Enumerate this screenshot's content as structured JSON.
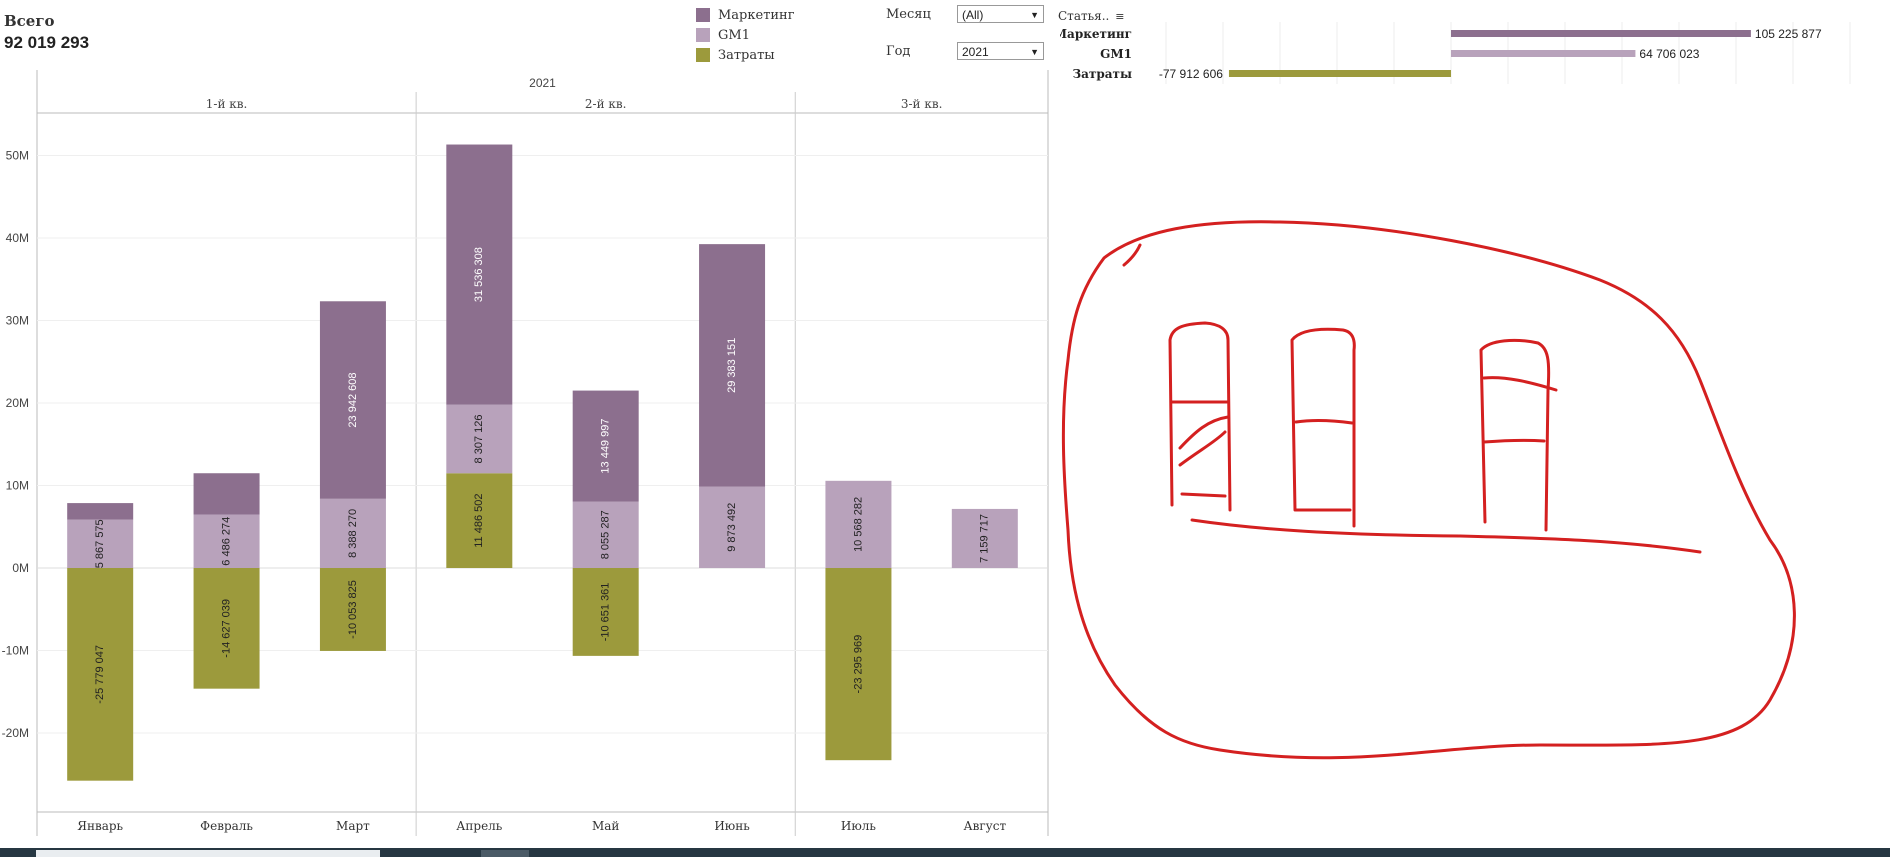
{
  "kpi": {
    "label": "Всего",
    "value": "92 019 293"
  },
  "legend": [
    {
      "name": "Маркетинг",
      "color": "#8c6f8e"
    },
    {
      "name": "GM1",
      "color": "#b8a2bb"
    },
    {
      "name": "Затраты",
      "color": "#9c9a3c"
    }
  ],
  "filters": {
    "month": {
      "label": "Месяц",
      "value": "(All)"
    },
    "year": {
      "label": "Год",
      "value": "2021"
    }
  },
  "stat_header": "Статья..",
  "chart_data": [
    {
      "type": "bar",
      "stacked": true,
      "year_header": "2021",
      "quarters": [
        {
          "label": "1-й кв.",
          "months": [
            "Январь",
            "Февраль",
            "Март"
          ]
        },
        {
          "label": "2-й кв.",
          "months": [
            "Апрель",
            "Май",
            "Июнь"
          ]
        },
        {
          "label": "3-й кв.",
          "months": [
            "Июль",
            "Август"
          ]
        }
      ],
      "categories": [
        "Январь",
        "Февраль",
        "Март",
        "Апрель",
        "Май",
        "Июнь",
        "Июль",
        "Август"
      ],
      "series": [
        {
          "name": "Затраты",
          "values": [
            -25779047,
            -14627039,
            -10053825,
            11486502,
            -10651361,
            null,
            -23295969,
            null
          ],
          "labels": [
            "-25 779 047",
            "-14 627 039",
            "-10 053 825",
            "11 486 502",
            "-10 651 361",
            "",
            "-23 295 969",
            ""
          ]
        },
        {
          "name": "GM1",
          "values": [
            5867575,
            6486274,
            8388270,
            8307126,
            8055287,
            9873492,
            10568282,
            7159717
          ],
          "labels": [
            "5 867 575",
            "6 486 274",
            "8 388 270",
            "8 307 126",
            "8 055 287",
            "9 873 492",
            "10 568 282",
            "7 159 717"
          ]
        },
        {
          "name": "Маркетинг",
          "values": [
            2000000,
            5000000,
            23942608,
            31536308,
            13449997,
            29383151,
            null,
            null
          ],
          "labels": [
            "",
            "",
            "23 942 608",
            "31 536 308",
            "13 449 997",
            "29 383 151",
            "",
            ""
          ]
        }
      ],
      "yticks": [
        "50M",
        "40M",
        "30M",
        "20M",
        "10M",
        "0M",
        "-10M",
        "-20M"
      ],
      "ylim": [
        -30000000,
        55000000
      ],
      "grid": true
    },
    {
      "type": "bar",
      "orientation": "horizontal",
      "categories": [
        "Маркетинг",
        "GM1",
        "Затраты"
      ],
      "values": [
        105225877,
        64706023,
        -77912606
      ],
      "labels": [
        "105 225 877",
        "64 706 023",
        "-77 912 606"
      ],
      "xlim": [
        -100000000,
        140000000
      ],
      "grid": true
    }
  ]
}
